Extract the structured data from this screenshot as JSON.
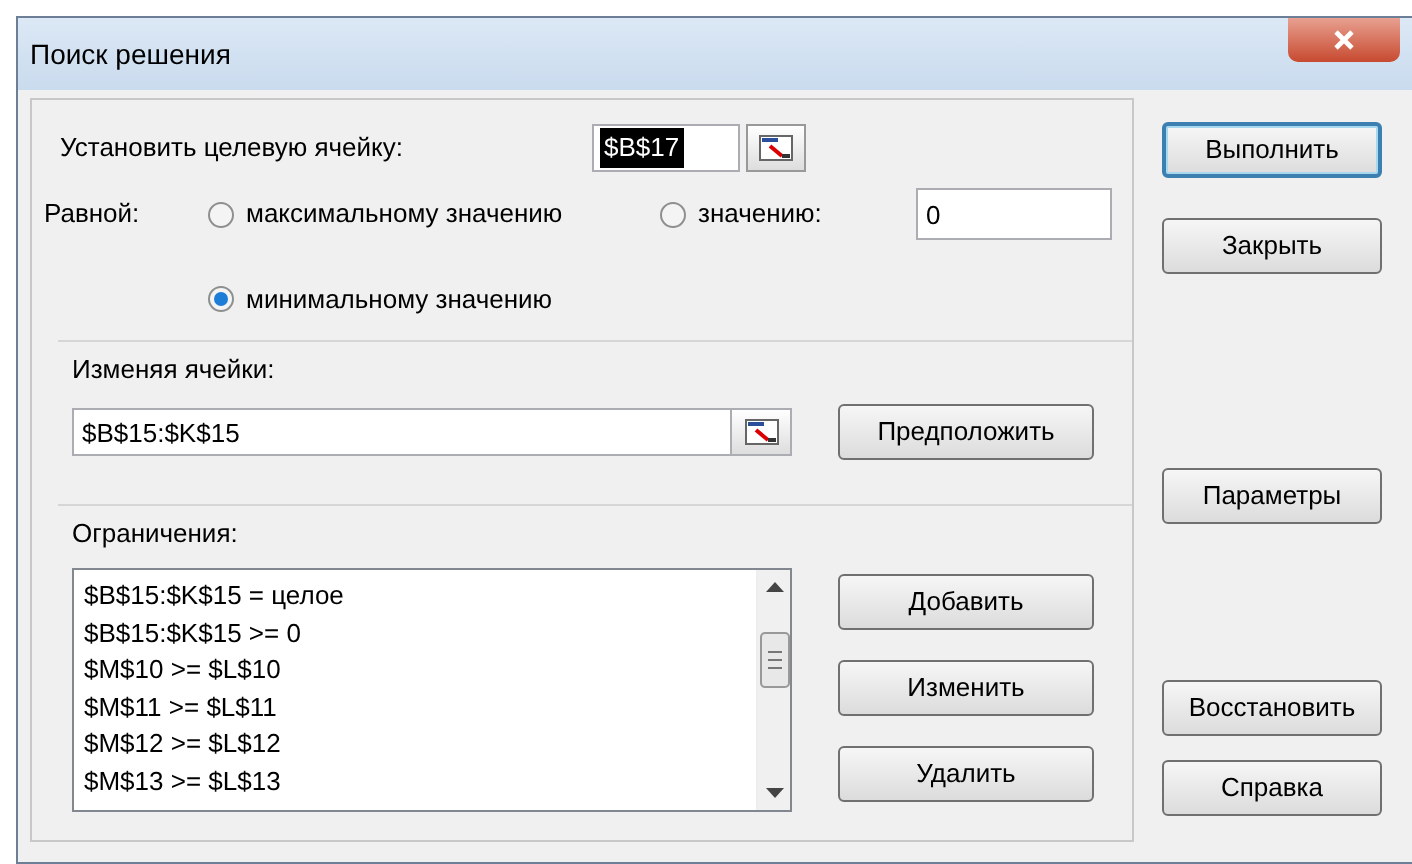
{
  "window": {
    "title": "Поиск решения"
  },
  "target": {
    "label": "Установить целевую ячейку:",
    "value": "$B$17",
    "selected": true
  },
  "equal": {
    "label": "Равной:",
    "options": [
      {
        "label": "максимальному значению",
        "selected": false
      },
      {
        "label": "значению:",
        "selected": false
      },
      {
        "label": "минимальному значению",
        "selected": true
      }
    ],
    "value": "0"
  },
  "changing": {
    "label": "Изменяя ячейки:",
    "value": "$B$15:$K$15",
    "button": "Предположить"
  },
  "constraints": {
    "label": "Ограничения:",
    "items": [
      "$B$15:$K$15 = целое",
      "$B$15:$K$15 >= 0",
      "$M$10 >= $L$10",
      "$M$11 >= $L$11",
      "$M$12 >= $L$12",
      "$M$13 >= $L$13"
    ],
    "buttons": [
      "Добавить",
      "Изменить",
      "Удалить"
    ]
  },
  "actions": [
    {
      "label": "Выполнить",
      "default": true
    },
    {
      "label": "Закрыть",
      "default": false
    }
  ],
  "options_button": {
    "label": "Параметры"
  },
  "actions_bottom": [
    {
      "label": "Восстановить",
      "default": false
    },
    {
      "label": "Справка",
      "default": false
    }
  ]
}
